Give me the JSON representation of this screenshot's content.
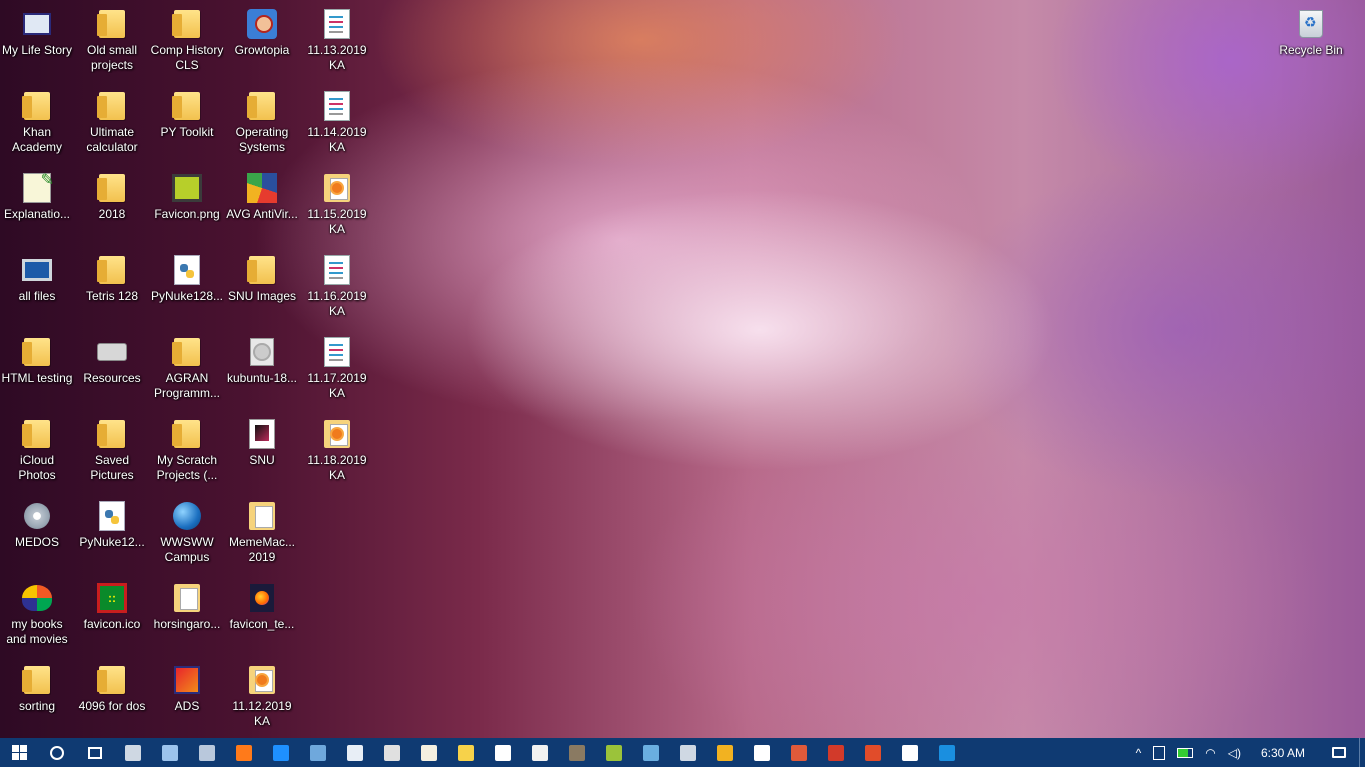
{
  "desktop": {
    "col1": [
      {
        "label": "My Life Story",
        "icon": "life-story-icon"
      },
      {
        "label": "Khan Academy",
        "icon": "folder-icon"
      },
      {
        "label": "Explanatio...",
        "icon": "explanation-file-icon"
      },
      {
        "label": "all files",
        "icon": "monitor-icon"
      },
      {
        "label": "HTML testing",
        "icon": "folder-icon"
      },
      {
        "label": "iCloud Photos",
        "icon": "folder-icon"
      },
      {
        "label": "MEDOS",
        "icon": "gear-icon"
      },
      {
        "label": "my books and movies",
        "icon": "butterfly-icon"
      },
      {
        "label": "sorting",
        "icon": "folder-icon"
      }
    ],
    "col2": [
      {
        "label": "Old small projects",
        "icon": "folder-icon"
      },
      {
        "label": "Ultimate calculator",
        "icon": "folder-icon"
      },
      {
        "label": "2018",
        "icon": "folder-icon"
      },
      {
        "label": "Tetris 128",
        "icon": "folder-icon"
      },
      {
        "label": "Resources",
        "icon": "drive-icon"
      },
      {
        "label": "Saved Pictures",
        "icon": "folder-icon"
      },
      {
        "label": "PyNuke12...",
        "icon": "python-file-icon"
      },
      {
        "label": "favicon.ico",
        "icon": "favicon-ico-icon"
      },
      {
        "label": "4096 for dos",
        "icon": "folder-icon"
      }
    ],
    "col3": [
      {
        "label": "Comp History CLS",
        "icon": "folder-icon"
      },
      {
        "label": "PY Toolkit",
        "icon": "folder-icon"
      },
      {
        "label": "Favicon.png",
        "icon": "png-image-icon"
      },
      {
        "label": "PyNuke128...",
        "icon": "python-file-icon"
      },
      {
        "label": "AGRAN Programm...",
        "icon": "folder-icon"
      },
      {
        "label": "My Scratch Projects (...",
        "icon": "folder-icon"
      },
      {
        "label": "WWSWW Campus",
        "icon": "globe-icon"
      },
      {
        "label": "horsingaro...",
        "icon": "image-folder-icon"
      },
      {
        "label": "ADS",
        "icon": "ads-app-icon"
      }
    ],
    "col4": [
      {
        "label": "Growtopia",
        "icon": "growtopia-icon"
      },
      {
        "label": "Operating Systems",
        "icon": "folder-icon"
      },
      {
        "label": "AVG AntiVir...",
        "icon": "avg-antivirus-icon"
      },
      {
        "label": "SNU Images",
        "icon": "folder-icon"
      },
      {
        "label": "kubuntu-18...",
        "icon": "disc-image-icon"
      },
      {
        "label": "SNU",
        "icon": "snu-file-icon"
      },
      {
        "label": "MemeMac... 2019",
        "icon": "document-folder-icon"
      },
      {
        "label": "favicon_te...",
        "icon": "firefox-file-icon"
      },
      {
        "label": "11.12.2019 KA",
        "icon": "orange-document-icon"
      }
    ],
    "col5": [
      {
        "label": "11.13.2019 KA",
        "icon": "document-icon"
      },
      {
        "label": "11.14.2019 KA",
        "icon": "document-icon"
      },
      {
        "label": "11.15.2019 KA",
        "icon": "orange-document-icon"
      },
      {
        "label": "11.16.2019 KA",
        "icon": "document-icon"
      },
      {
        "label": "11.17.2019 KA",
        "icon": "document-icon"
      },
      {
        "label": "11.18.2019 KA",
        "icon": "orange-document-icon"
      }
    ],
    "recycle_bin": {
      "label": "Recycle Bin",
      "icon": "recycle-bin-icon"
    }
  },
  "taskbar": {
    "start_icon": "windows-start-icon",
    "search_icon": "cortana-search-icon",
    "task_view_icon": "task-view-icon",
    "apps": [
      {
        "name": "this-pc",
        "color": "#cfd8e3"
      },
      {
        "name": "app-2",
        "color": "#9cc3ec"
      },
      {
        "name": "app-3",
        "color": "#b9c8dc"
      },
      {
        "name": "firefox",
        "color": "#ff7a1a"
      },
      {
        "name": "edge",
        "color": "#1e90ff"
      },
      {
        "name": "remote-desktop",
        "color": "#6fa8dc"
      },
      {
        "name": "notepad",
        "color": "#e8eef6"
      },
      {
        "name": "calculator",
        "color": "#e0e0e0"
      },
      {
        "name": "app-9",
        "color": "#f5f0e0"
      },
      {
        "name": "app-10",
        "color": "#f7d24a"
      },
      {
        "name": "app-11",
        "color": "#ffffff"
      },
      {
        "name": "app-12",
        "color": "#f1f1f1"
      },
      {
        "name": "gimp",
        "color": "#8a7a62"
      },
      {
        "name": "app-14",
        "color": "#9bc33a"
      },
      {
        "name": "app-15",
        "color": "#6aaee0"
      },
      {
        "name": "app-16",
        "color": "#cfd8e3"
      },
      {
        "name": "app-17",
        "color": "#f2b221"
      },
      {
        "name": "7zip",
        "color": "#ffffff"
      },
      {
        "name": "app-19",
        "color": "#e05a3a"
      },
      {
        "name": "app-20",
        "color": "#d23a2a"
      },
      {
        "name": "app-21",
        "color": "#e14c2a"
      },
      {
        "name": "settings",
        "color": "#ffffff"
      },
      {
        "name": "app-23",
        "color": "#1a8fe0"
      }
    ],
    "tray": {
      "chevron": "^",
      "clock": "6:30 AM"
    }
  }
}
